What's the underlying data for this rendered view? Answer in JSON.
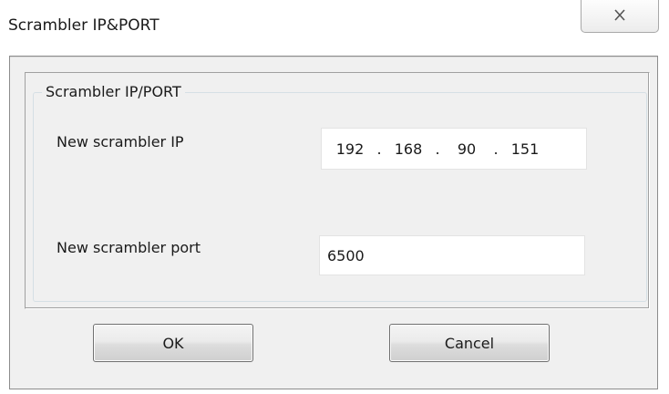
{
  "window": {
    "title": "Scrambler IP&PORT",
    "close_icon": "close-icon",
    "close_glyph": "☒"
  },
  "group": {
    "legend": "Scrambler IP/PORT"
  },
  "ip": {
    "label": "New scrambler IP",
    "octets": [
      "192",
      "168",
      "90",
      "151"
    ],
    "separator": "."
  },
  "port": {
    "label": "New scrambler port",
    "value": "6500"
  },
  "buttons": {
    "ok_label": "OK",
    "cancel_label": "Cancel"
  },
  "colors": {
    "dialog_background": "#f0f0f0",
    "field_background": "#ffffff",
    "button_border": "#707070"
  }
}
